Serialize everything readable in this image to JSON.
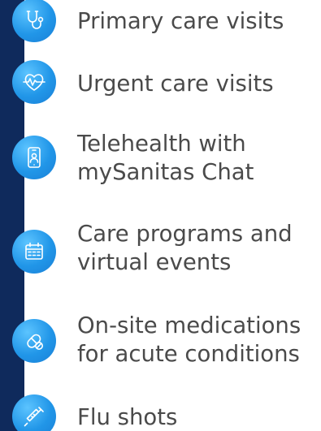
{
  "colors": {
    "side_bar": "#0f2a5c",
    "icon_fill": "#2196e8",
    "text": "#4a4a4a"
  },
  "items": [
    {
      "icon": "stethoscope-icon",
      "lines": [
        "Primary care visits"
      ]
    },
    {
      "icon": "heart-pulse-icon",
      "lines": [
        "Urgent care visits"
      ]
    },
    {
      "icon": "smartphone-doctor-icon",
      "lines": [
        "Telehealth with",
        "mySanitas Chat"
      ]
    },
    {
      "icon": "calendar-icon",
      "lines": [
        "Care programs and",
        "virtual events"
      ]
    },
    {
      "icon": "pill-capsule-icon",
      "lines": [
        "On-site medications",
        "for acute conditions"
      ]
    },
    {
      "icon": "syringe-icon",
      "lines": [
        "Flu shots"
      ]
    }
  ]
}
